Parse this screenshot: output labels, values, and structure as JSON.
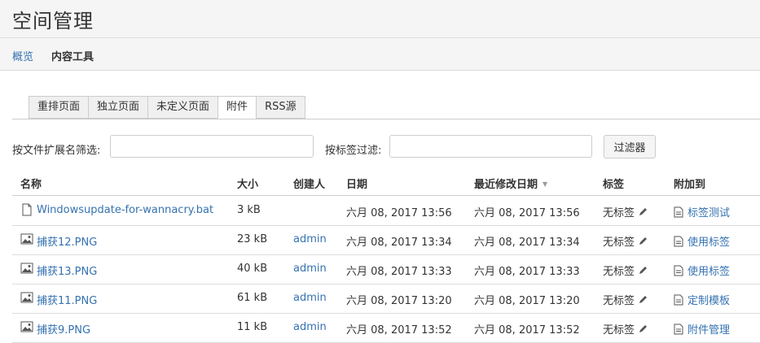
{
  "page": {
    "title": "空间管理"
  },
  "subnav": {
    "overview": "概览",
    "content_tools": "内容工具"
  },
  "tabs": [
    {
      "label": "重排页面",
      "active": false
    },
    {
      "label": "独立页面",
      "active": false
    },
    {
      "label": "未定义页面",
      "active": false
    },
    {
      "label": "附件",
      "active": true
    },
    {
      "label": "RSS源",
      "active": false
    }
  ],
  "filters": {
    "extension_label": "按文件扩展名筛选:",
    "extension_value": "",
    "label_label": "按标签过滤:",
    "label_value": "",
    "button": "过滤器"
  },
  "table": {
    "headers": {
      "name": "名称",
      "size": "大小",
      "creator": "创建人",
      "date": "日期",
      "modified": "最近修改日期",
      "labels": "标签",
      "attached_to": "附加到"
    },
    "rows": [
      {
        "icon": "file-icon",
        "name": "Windowsupdate-for-wannacry.bat",
        "size": "3 kB",
        "creator": "",
        "date": "六月 08, 2017 13:56",
        "modified": "六月 08, 2017 13:56",
        "labels": "无标签",
        "attached_to": "标签测试"
      },
      {
        "icon": "image-icon",
        "name": "捕获12.PNG",
        "size": "23 kB",
        "creator": "admin",
        "date": "六月 08, 2017 13:34",
        "modified": "六月 08, 2017 13:34",
        "labels": "无标签",
        "attached_to": "使用标签"
      },
      {
        "icon": "image-icon",
        "name": "捕获13.PNG",
        "size": "40 kB",
        "creator": "admin",
        "date": "六月 08, 2017 13:33",
        "modified": "六月 08, 2017 13:33",
        "labels": "无标签",
        "attached_to": "使用标签"
      },
      {
        "icon": "image-icon",
        "name": "捕获11.PNG",
        "size": "61 kB",
        "creator": "admin",
        "date": "六月 08, 2017 13:20",
        "modified": "六月 08, 2017 13:20",
        "labels": "无标签",
        "attached_to": "定制模板"
      },
      {
        "icon": "image-icon",
        "name": "捕获9.PNG",
        "size": "11 kB",
        "creator": "admin",
        "date": "六月 08, 2017 13:52",
        "modified": "六月 08, 2017 13:52",
        "labels": "无标签",
        "attached_to": "附件管理"
      }
    ]
  },
  "colors": {
    "link": "#3572b0",
    "header_bg": "#f5f5f5",
    "border": "#cccccc"
  }
}
